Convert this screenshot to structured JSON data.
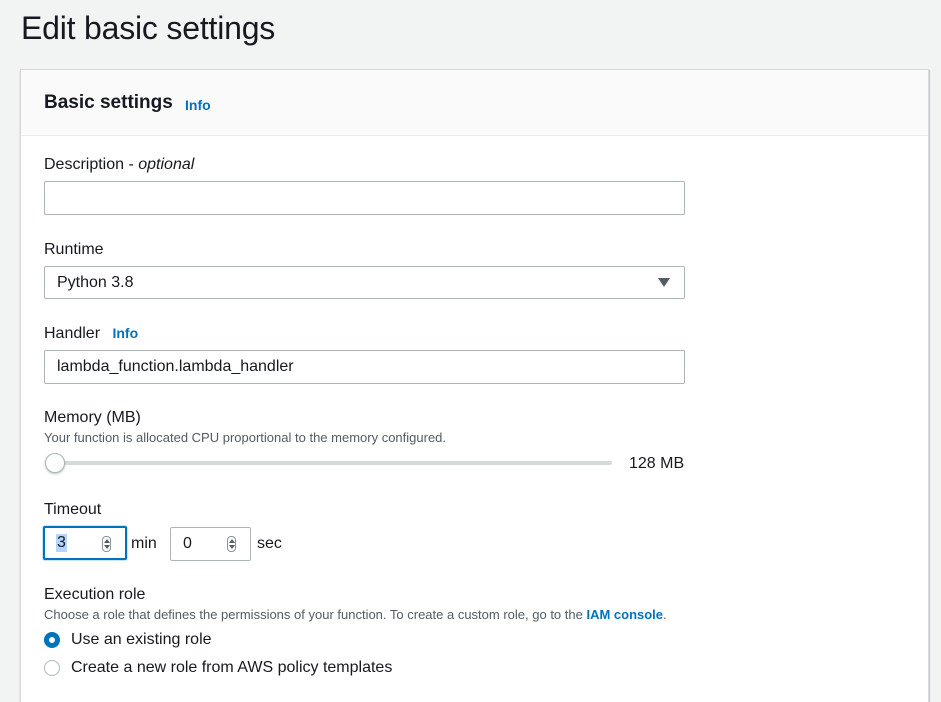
{
  "page": {
    "title": "Edit basic settings"
  },
  "panel": {
    "title": "Basic settings",
    "info": "Info"
  },
  "description": {
    "label": "Description",
    "optional": "optional",
    "value": "",
    "placeholder": ""
  },
  "runtime": {
    "label": "Runtime",
    "selected": "Python 3.8",
    "icon": "caret-down-icon"
  },
  "handler": {
    "label": "Handler",
    "info": "Info",
    "value": "lambda_function.lambda_handler"
  },
  "memory": {
    "label": "Memory (MB)",
    "hint": "Your function is allocated CPU proportional to the memory configured.",
    "value_text": "128 MB",
    "slider_value": 128
  },
  "timeout": {
    "label": "Timeout",
    "min_value": "3",
    "min_unit": "min",
    "sec_value": "0",
    "sec_unit": "sec"
  },
  "execution_role": {
    "label": "Execution role",
    "hint_prefix": "Choose a role that defines the permissions of your function. To create a custom role, go to the ",
    "hint_link": "IAM console",
    "hint_suffix": ".",
    "options": [
      {
        "label": "Use an existing role",
        "checked": true
      },
      {
        "label": "Create a new role from AWS policy templates",
        "checked": false
      }
    ]
  },
  "colors": {
    "accent": "#0073bb",
    "page_bg": "#f2f3f3",
    "text": "#16191f"
  }
}
